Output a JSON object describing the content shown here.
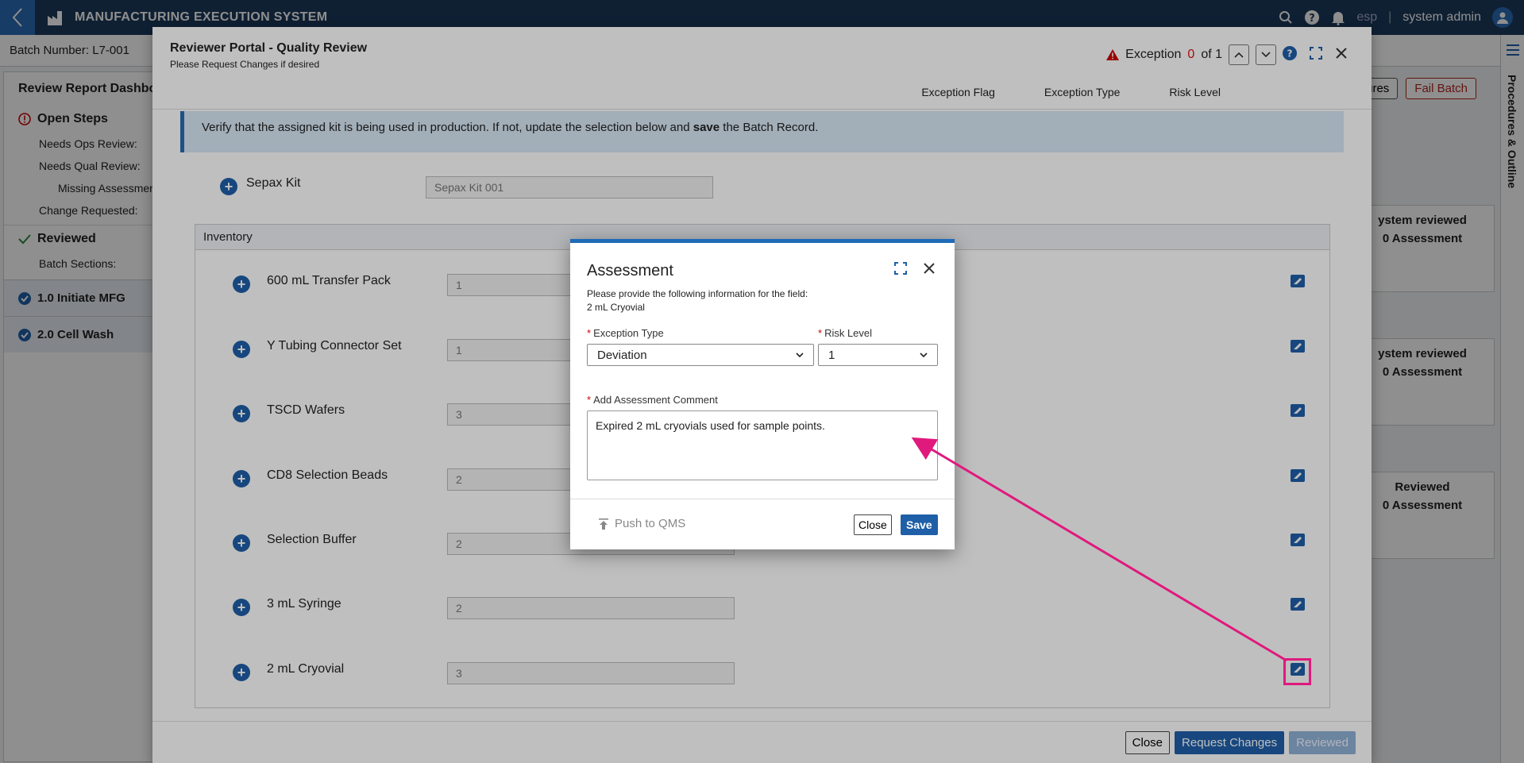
{
  "app": {
    "title": "MANUFACTURING EXECUTION SYSTEM",
    "language": "esp",
    "user": "system admin"
  },
  "background": {
    "batch_number": "Batch Number: L7-001",
    "actions": [
      "natures",
      "Fail Batch"
    ],
    "left_panel": {
      "title": "Review Report Dashbo",
      "open_steps": "Open Steps",
      "rows": [
        "Needs Ops Review:",
        "Needs Qual Review:",
        "Missing Assessment",
        "Change Requested:"
      ],
      "reviewed": "Reviewed",
      "batch_sections": "Batch Sections:",
      "sections": [
        "1.0 Initiate MFG",
        "2.0 Cell Wash"
      ]
    },
    "right_rail_label": "Procedures & Outline",
    "right_cards": [
      {
        "status": "ystem reviewed",
        "assessment": "0 Assessment"
      },
      {
        "status": "ystem reviewed",
        "assessment": "0 Assessment"
      },
      {
        "status": "Reviewed",
        "assessment": "0 Assessment"
      }
    ]
  },
  "portal": {
    "title": "Reviewer Portal - Quality Review",
    "subtitle": "Please Request Changes if desired",
    "exception_label": "Exception",
    "exception_current": "0",
    "exception_of": "of 1",
    "columns": [
      "Exception Flag",
      "Exception Type",
      "Risk Level"
    ],
    "banner_text": "Verify that the assigned kit is being used in production. If not, update the selection below and",
    "banner_bold": "save",
    "banner_tail": "the Batch Record.",
    "kit": {
      "label": "Sepax Kit",
      "value": "Sepax Kit 001"
    },
    "inventory_title": "Inventory",
    "inventory": [
      {
        "label": "600 mL Transfer Pack",
        "value": "1"
      },
      {
        "label": "Y Tubing Connector Set",
        "value": "1"
      },
      {
        "label": "TSCD Wafers",
        "value": "3"
      },
      {
        "label": "CD8 Selection Beads",
        "value": "2"
      },
      {
        "label": "Selection Buffer",
        "value": "2"
      },
      {
        "label": "3 mL Syringe",
        "value": "2"
      },
      {
        "label": "2 mL Cryovial",
        "value": "3"
      }
    ],
    "footer": {
      "close": "Close",
      "request_changes": "Request Changes",
      "reviewed": "Reviewed"
    }
  },
  "assessment": {
    "title": "Assessment",
    "desc_line1": "Please provide the following information for the field:",
    "desc_line2": "2 mL Cryovial",
    "exception_type_label": "Exception Type",
    "exception_type_value": "Deviation",
    "risk_level_label": "Risk Level",
    "risk_level_value": "1",
    "comment_label": "Add Assessment Comment",
    "comment_value": "Expired 2 mL cryovials used for sample points.",
    "push_qms": "Push to QMS",
    "close": "Close",
    "save": "Save"
  },
  "colors": {
    "brand": "#1b3a5c",
    "primary": "#1f5fa8",
    "annotation": "#e0197d",
    "required": "#cc0000"
  }
}
